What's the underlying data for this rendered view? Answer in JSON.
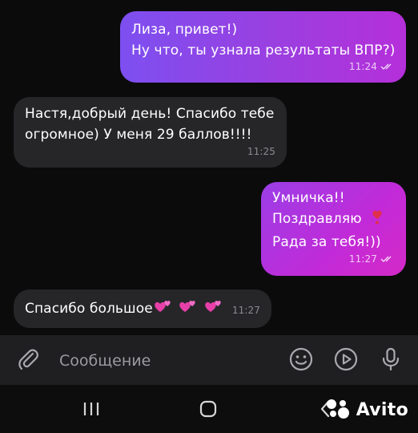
{
  "messages": [
    {
      "lines": [
        "Лиза, привет!)",
        "Ну что, ты узнала результаты ВПР?)"
      ],
      "time": "11:24",
      "direction": "outgoing"
    },
    {
      "lines": [
        "Настя,добрый день! Спасибо тебе",
        "огромное) У меня 29 баллов!!!!"
      ],
      "time": "11:25",
      "direction": "incoming"
    },
    {
      "lines": [
        "Умничка!!",
        "Поздравляю",
        "Рада за тебя!))"
      ],
      "time": "11:27",
      "direction": "outgoing"
    },
    {
      "lines": [
        "Спасибо большое"
      ],
      "time": "11:27",
      "direction": "incoming"
    }
  ],
  "composer": {
    "placeholder": "Сообщение",
    "icons": [
      "attach-icon",
      "emoji-icon",
      "gif-icon",
      "microphone-icon"
    ]
  },
  "nav_icons": [
    "recent-apps-icon",
    "home-icon",
    "back-icon"
  ],
  "watermark": {
    "text": "Avito"
  },
  "colors": {
    "background": "#0b0b0c",
    "incoming_bubble": "#262629",
    "outgoing_gradient": [
      "#7d4ff0",
      "#b52fd9"
    ],
    "composer": "#1f1f21"
  }
}
